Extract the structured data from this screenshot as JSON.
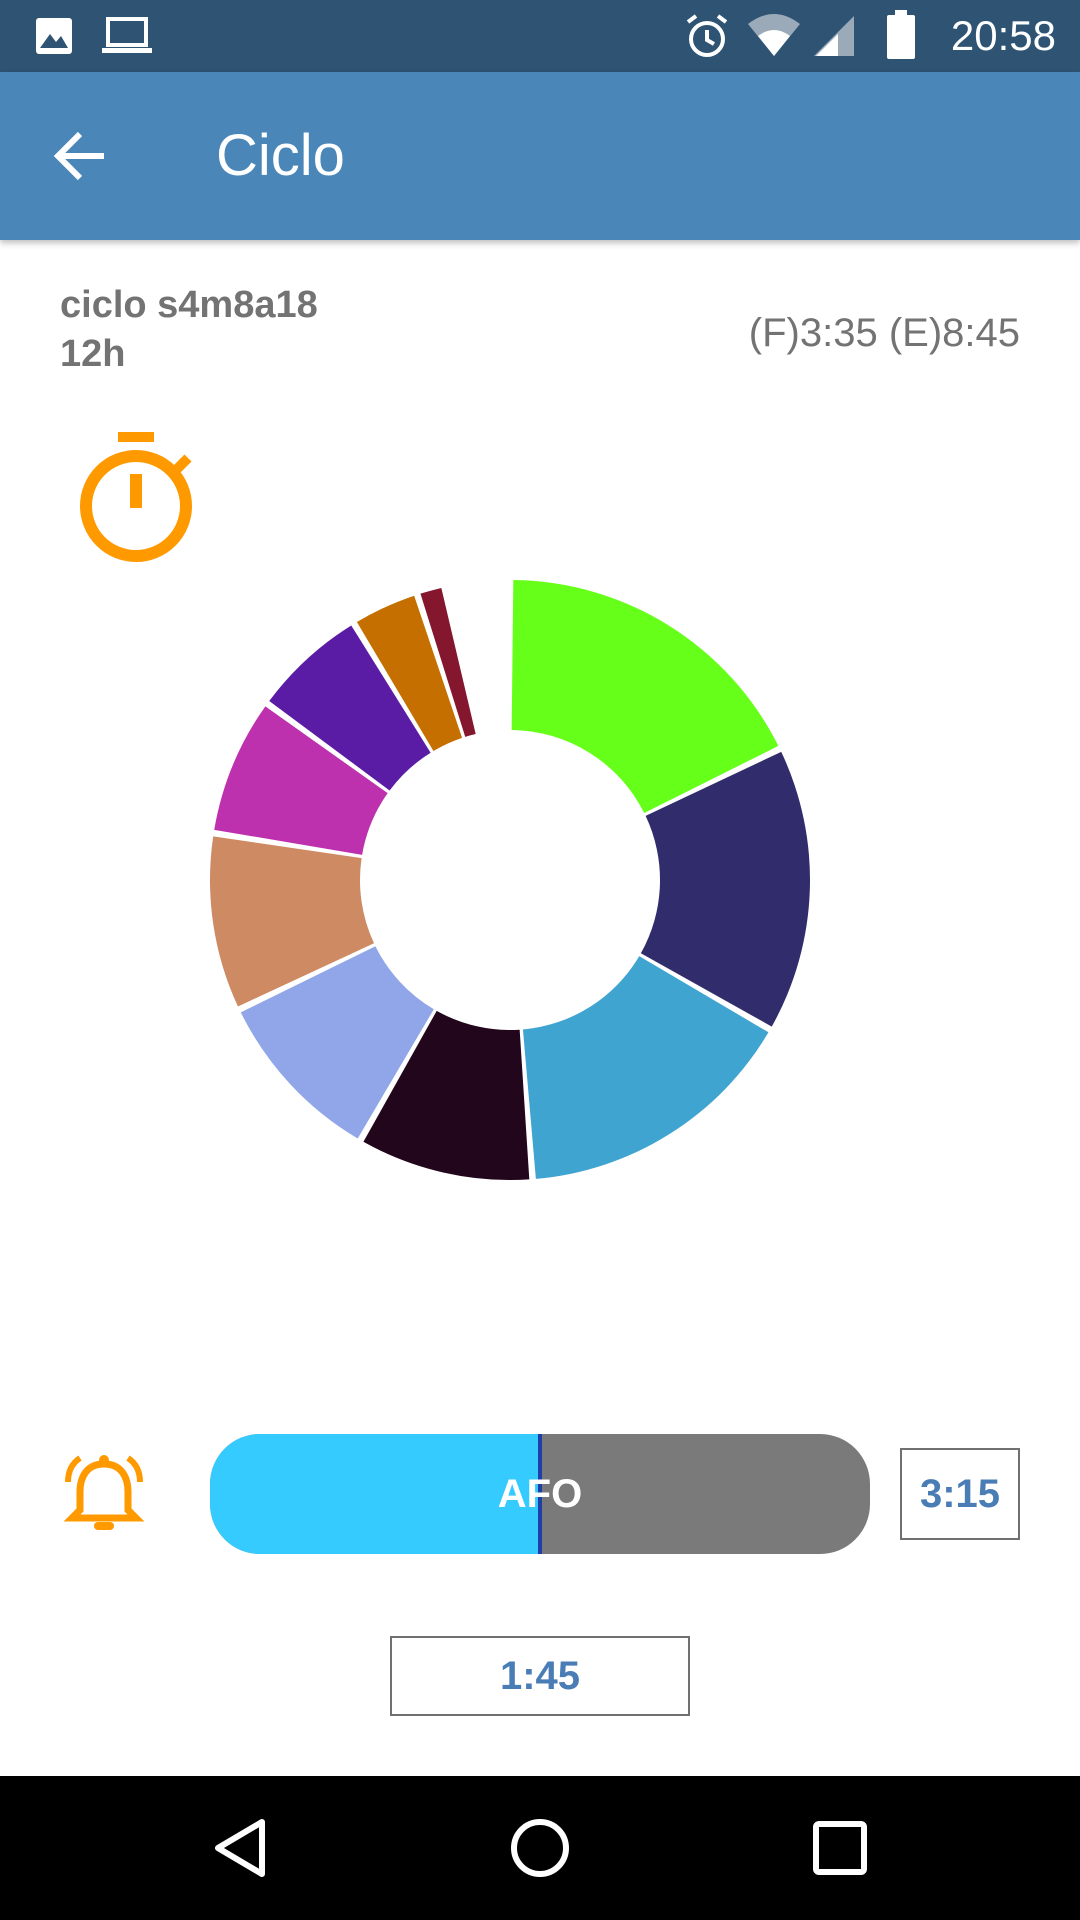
{
  "status_bar": {
    "time": "20:58",
    "icons": [
      "image-icon",
      "laptop-icon",
      "alarm-icon",
      "wifi-icon",
      "signal-icon",
      "battery-icon"
    ]
  },
  "app_bar": {
    "title": "Ciclo",
    "back_icon": "arrow-left-icon"
  },
  "cycle": {
    "name": "ciclo s4m8a18",
    "duration": "12h",
    "times": "(F)3:35 (E)8:45"
  },
  "stopwatch_icon": "stopwatch-icon",
  "colors": {
    "accent": "#ff9900",
    "app_bar": "#4a86b8",
    "status_bar": "#2e5373",
    "progress_fill": "#35cbff",
    "progress_track": "#7a7a7a",
    "time_text": "#4a7db5"
  },
  "cycle_segments": [
    {
      "fraction": 0.178,
      "color": "#66ff19"
    },
    {
      "fraction": 0.155,
      "color": "#312c6b"
    },
    {
      "fraction": 0.155,
      "color": "#40a4d1"
    },
    {
      "fraction": 0.095,
      "color": "#22061b"
    },
    {
      "fraction": 0.096,
      "color": "#91a5e9"
    },
    {
      "fraction": 0.096,
      "color": "#cd8a63"
    },
    {
      "fraction": 0.075,
      "color": "#bd31ae"
    },
    {
      "fraction": 0.063,
      "color": "#5a1ca5"
    },
    {
      "fraction": 0.037,
      "color": "#c46f00"
    },
    {
      "fraction": 0.015,
      "color": "#84162d"
    }
  ],
  "progress": {
    "label": "AFO",
    "fraction": 0.5
  },
  "bell_icon": "bell-icon",
  "time_right": "3:15",
  "time_center": "1:45",
  "nav_bar": {
    "icons": [
      "back-triangle-icon",
      "home-circle-icon",
      "recents-square-icon"
    ]
  }
}
